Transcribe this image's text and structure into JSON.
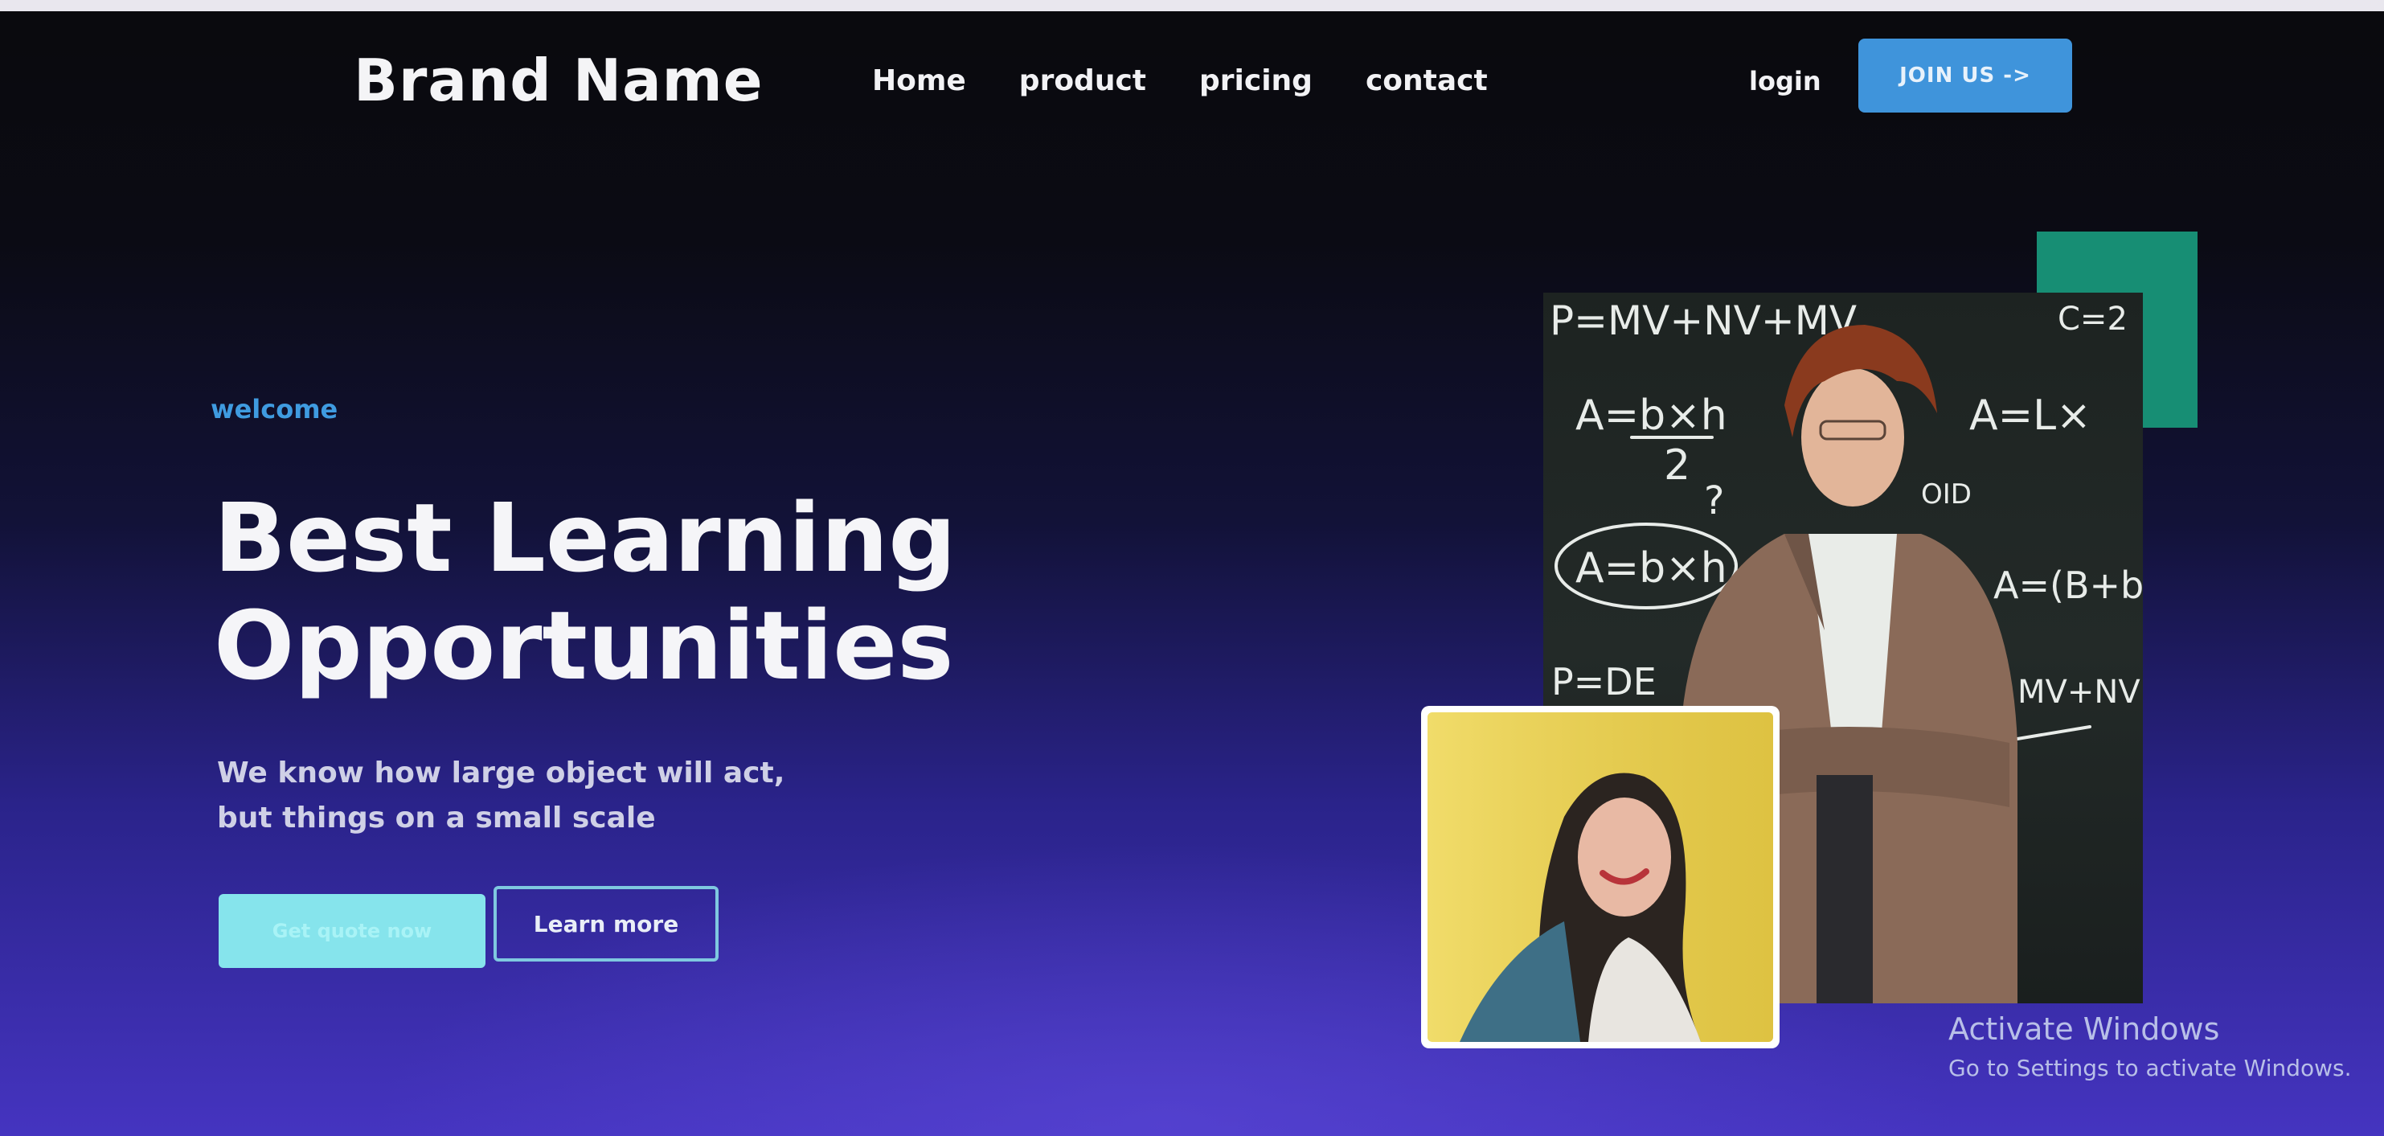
{
  "nav": {
    "brand": "Brand Name",
    "links": [
      "Home",
      "product",
      "pricing",
      "contact"
    ],
    "login": "login",
    "join": "JOIN US ->"
  },
  "hero": {
    "eyebrow": "welcome",
    "headline_line1": "Best Learning",
    "headline_line2": "Opportunities",
    "subtext_line1": "We know how large object will act,",
    "subtext_line2": "but things on a small scale",
    "primary_cta": "Get quote now",
    "secondary_cta": "Learn more"
  },
  "images": {
    "main_photo": "teacher-photo",
    "chalkboard_formulas": [
      "P=MV+NV+MV",
      "A=b×h",
      "2",
      "A=b×h",
      "A=L×",
      "P=DE",
      "A=(B+b)",
      "MV+NV=P",
      "OID",
      "C=2"
    ],
    "secondary_photo": "student-photo"
  },
  "watermark": {
    "title": "Activate Windows",
    "subtitle": "Go to Settings to activate Windows."
  },
  "colors": {
    "accent_blue": "#3f94db",
    "cta_cyan": "#86e4ec",
    "green_block": "#178e74",
    "eyebrow": "#3f9be0"
  }
}
